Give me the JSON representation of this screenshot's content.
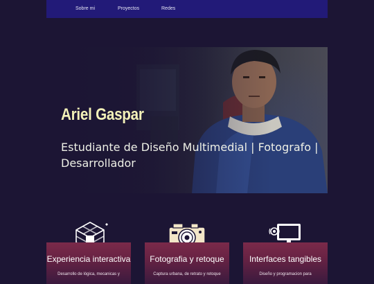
{
  "nav": {
    "items": [
      {
        "label": "Sobre mi"
      },
      {
        "label": "Proyectos"
      },
      {
        "label": "Redes"
      }
    ]
  },
  "hero": {
    "name": "Ariel Gaspar",
    "subtitle": "Estudiante de Diseño Multimedial | Fotografo | Desarrollador"
  },
  "services": [
    {
      "icon": "cube-icon",
      "title": "Experiencia interactiva",
      "description": "Desarrollo de lógica, mecanicas y"
    },
    {
      "icon": "camera-icon",
      "title": "Fotografia y retoque",
      "description": "Captura urbana, de retrato y retoque"
    },
    {
      "icon": "computer-icon",
      "title": "Interfaces tangibles",
      "description": "Diseño y programacion para"
    }
  ],
  "colors": {
    "background": "#1c1534",
    "navbar": "#221a78",
    "name_accent": "#f3f1b8",
    "card_top": "#7a2a4a"
  }
}
